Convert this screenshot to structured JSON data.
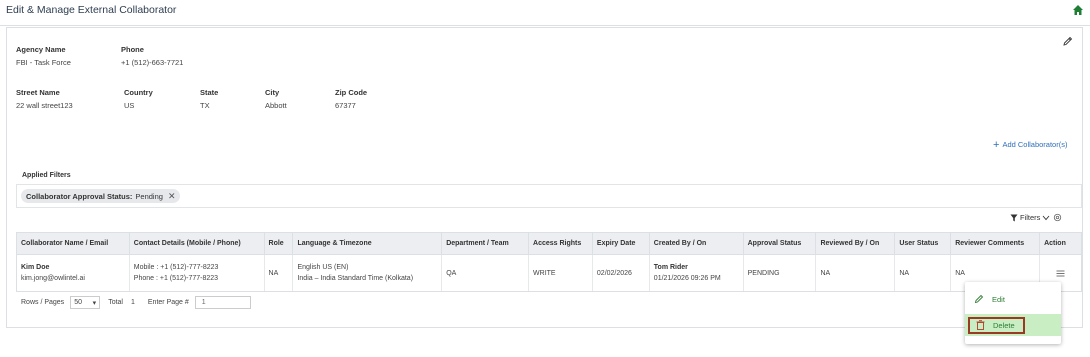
{
  "header": {
    "title": "Edit & Manage External Collaborator"
  },
  "agency": {
    "agency_name_label": "Agency Name",
    "agency_name": "FBI - Task Force",
    "phone_label": "Phone",
    "phone": "+1 (512)-663-7721",
    "street_label": "Street Name",
    "street": "22 wall street123",
    "country_label": "Country",
    "country": "US",
    "state_label": "State",
    "state": "TX",
    "city_label": "City",
    "city": "Abbott",
    "zip_label": "Zip Code",
    "zip": "67377"
  },
  "add_collaborator_label": "Add Collaborator(s)",
  "applied_filters": {
    "label": "Applied Filters",
    "chip_key": "Collaborator Approval Status:",
    "chip_value": "Pending"
  },
  "filters_label": "Filters",
  "table": {
    "headers": [
      "Collaborator Name / Email",
      "Contact Details (Mobile / Phone)",
      "Role",
      "Language & Timezone",
      "Department / Team",
      "Access Rights",
      "Expiry Date",
      "Created By / On",
      "Approval Status",
      "Reviewed By / On",
      "User Status",
      "Reviewer Comments",
      "Action"
    ],
    "row": {
      "name": "Kim Doe",
      "email": "kim.jong@owlintel.ai",
      "mobile": "Mobile : +1 (512)-777-8223",
      "phone": "Phone : +1 (512)-777-8223",
      "role": "NA",
      "language": "English US (EN)",
      "timezone": "India – India Standard Time (Kolkata)",
      "department": "QA",
      "access": "WRITE",
      "expiry": "02/02/2026",
      "created_by": "Tom Rider",
      "created_on": "01/21/2026 09:26 PM",
      "approval": "PENDING",
      "reviewed": "NA",
      "user_status": "NA",
      "comments": "NA"
    }
  },
  "pager": {
    "rows_label": "Rows / Pages",
    "rows_value": "50",
    "total_label": "Total",
    "total_value": "1",
    "enter_page_label": "Enter Page #",
    "page_placeholder": "1"
  },
  "action_menu": {
    "edit_label": "Edit",
    "delete_label": "Delete"
  },
  "colors": {
    "accent": "#2f6fba",
    "menu_text": "#2e7d32",
    "delete_highlight": "#c9eec4",
    "home": "#1e7e34"
  }
}
